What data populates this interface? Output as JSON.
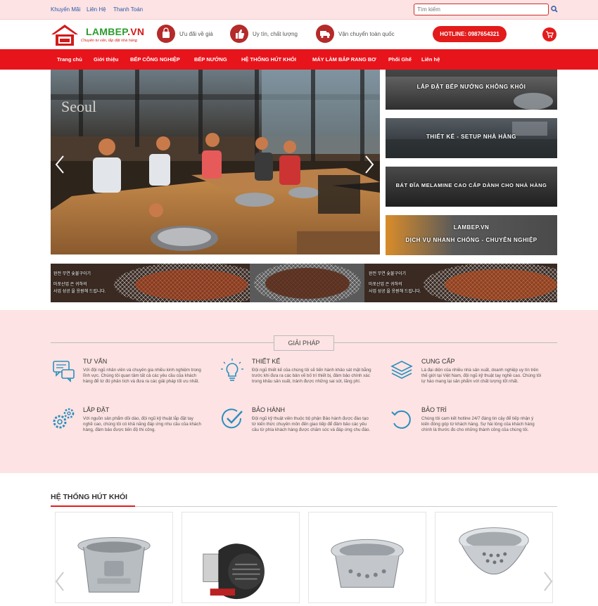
{
  "topbar": {
    "links": [
      "Khuyến Mãi",
      "Liên Hệ",
      "Thanh Toán"
    ],
    "search_placeholder": "Tìm kiếm"
  },
  "header": {
    "logo_main": "LAMBEP",
    "logo_ext": ".VN",
    "logo_slogan": "Chuyên tư vấn, lắp đặt nhà hàng",
    "features": [
      "Ưu đãi về giá",
      "Uy tín, chất lượng",
      "Vận chuyển toàn quốc"
    ],
    "hotline": "HOTLINE: 0987654321"
  },
  "nav": [
    "Trang chủ",
    "Giới thiệu",
    "BẾP CÔNG NGHIỆP",
    "BẾP NƯỚNG",
    "HỆ THỐNG HÚT KHÓI",
    "MÁY LÀM BẮP RANG BƠ",
    "Phối Ghế",
    "Liên hệ"
  ],
  "side_banners": [
    "LẮP ĐẶT BẾP NƯỚNG KHÔNG KHÓI",
    "THIẾT KẾ - SETUP NHÀ HÀNG",
    "BÁT ĐĨA MELAMINE CAO CẤP DÀNH CHO NHÀ HÀNG",
    "LAMBEP.VN",
    "DỊCH VỤ NHANH CHÓNG - CHUYÊN NGHIỆP"
  ],
  "promo_texts": [
    "완전 무연 숯불구이기",
    "마포산업 은 귀하의",
    "사업 성공 을 응원해 드립니다."
  ],
  "solutions": {
    "title": "GIẢI PHÁP",
    "items": [
      {
        "title": "TƯ VẤN",
        "desc": "Với đội ngũ nhân viên và chuyên gia nhiều kinh nghiệm trong lĩnh vực. Chúng tôi quan tâm tất cả các yêu cầu của khách hàng để từ đó phân tích và đưa ra các giải pháp tối ưu nhất."
      },
      {
        "title": "THIẾT KẾ",
        "desc": "Đội ngũ thiết kế của chúng tôi sẽ tiến hành khảo sát mặt bằng trước khi đưa ra các bản vẽ bố trí thiết bị, đảm bảo chính xác trong khâu sản xuất, tránh được những sai sót, lãng phí."
      },
      {
        "title": "CUNG CẤP",
        "desc": "Là đại diện của nhiều nhà sản xuất, doanh nghiệp uy tín trên thế giới tại Việt Nam, đội ngũ kỹ thuật tay nghề cao. Chúng tôi tự hào mang lại sản phẩm với chất lượng tốt nhất."
      },
      {
        "title": "LẮP ĐẶT",
        "desc": "Với nguồn sản phẩm dồi dào, đội ngũ kỹ thuật lắp đặt tay nghề cao, chúng tôi có khả năng đáp ứng nhu cầu của khách hàng, đảm bảo được tiến độ thi công."
      },
      {
        "title": "BẢO HÀNH",
        "desc": "Đội ngũ kỹ thuật viên thuộc bộ phận Bảo hành được đào tạo từ kiến thức chuyên môn đến giao tiếp để đảm bảo các yêu cầu từ phía khách hàng được chăm sóc và đáp ứng chu đáo."
      },
      {
        "title": "BẢO TRÌ",
        "desc": "Chúng tôi cam kết hotline 24/7 đáng tin cậy để tiếp nhận ý kiến đóng góp từ khách hàng. Sự hài lòng của khách hàng chính là thước đo cho những thành công của chúng tôi."
      }
    ]
  },
  "products_section": {
    "title": "HỆ THỐNG HÚT KHÓI"
  },
  "colors": {
    "accent": "#e8141b",
    "pink_bg": "#fde3e3",
    "icon_blue": "#2a8fbd"
  }
}
